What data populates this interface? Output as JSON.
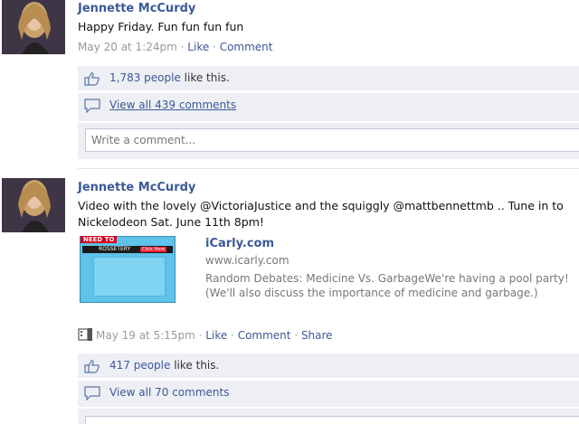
{
  "posts": [
    {
      "author": "Jennette McCurdy",
      "message": "Happy Friday. Fun fun fun fun",
      "meta": {
        "timestamp": "May 20 at 1:24pm",
        "sep1": " · ",
        "like": "Like",
        "sep2": " · ",
        "comment": "Comment"
      },
      "likes": {
        "count": "1,783 people",
        "suffix": " like this."
      },
      "comments": {
        "view_all": "View all 439 comments"
      },
      "comment_input": {
        "placeholder": "Write a comment..."
      }
    },
    {
      "author": "Jennette McCurdy",
      "message": "Video with the lovely @VictoriaJustice and the squiggly @mattbennettmb .. Tune in to Nickelodeon Sat. June 11th 8pm!",
      "attachment": {
        "thumb_banner": "NEED TO",
        "thumb_label": "ROSSETERY",
        "thumb_button": "Click Here",
        "title": "iCarly.com",
        "url": "www.icarly.com",
        "description": "Random Debates: Medicine Vs. GarbageWe're having a pool party! (We'll also discuss the importance of medicine and garbage.)"
      },
      "meta": {
        "timestamp": "May 19 at 5:15pm",
        "sep1": " · ",
        "like": "Like",
        "sep2": " · ",
        "comment": "Comment",
        "sep3": " · ",
        "share": "Share"
      },
      "likes": {
        "count": "417 people",
        "suffix": " like this."
      },
      "comments": {
        "view_all": "View all 70 comments"
      }
    }
  ],
  "colors": {
    "link": "#3b5998",
    "feedback_bg": "#edeff4",
    "meta": "#999999"
  }
}
